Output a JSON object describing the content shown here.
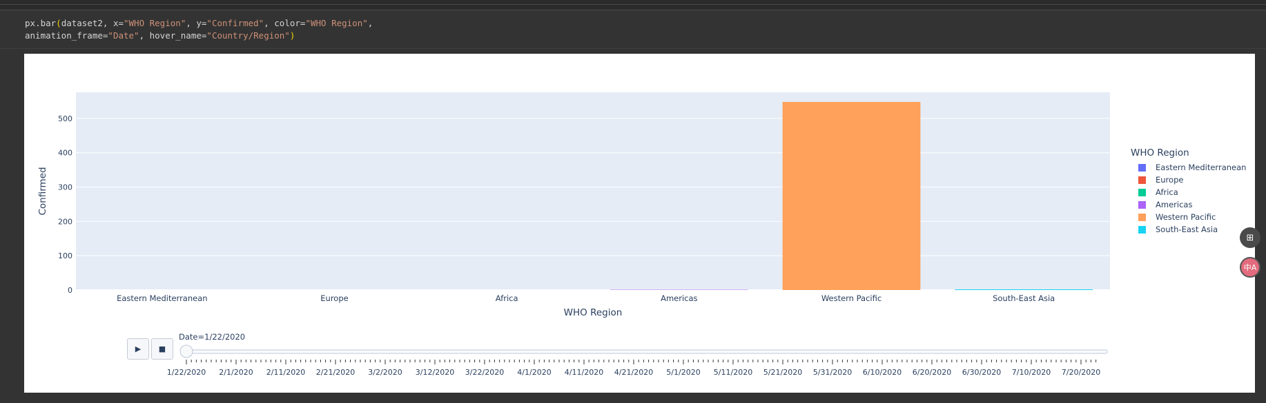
{
  "code": {
    "line1_prefix": "px.bar",
    "line1_paren_open": "(",
    "line1_a": "dataset2, x=",
    "line1_x": "\"WHO Region\"",
    "line1_b": ", y=",
    "line1_y": "\"Confirmed\"",
    "line1_c": ", color=",
    "line1_color": "\"WHO Region\"",
    "line1_d": ",",
    "line2_a": "animation_frame=",
    "line2_anim": "\"Date\"",
    "line2_b": ", hover_name=",
    "line2_hover": "\"Country/Region\"",
    "line2_paren_close": ")"
  },
  "chart_data": {
    "type": "bar",
    "xlabel": "WHO Region",
    "ylabel": "Confirmed",
    "categories": [
      "Eastern Mediterranean",
      "Europe",
      "Africa",
      "Americas",
      "Western Pacific",
      "South-East Asia"
    ],
    "values": [
      0,
      0,
      0,
      1,
      548,
      2
    ],
    "colors": [
      "#636efa",
      "#ef553b",
      "#00cc96",
      "#ab63fa",
      "#ffa15a",
      "#19d3f3"
    ],
    "yticks": [
      0,
      100,
      200,
      300,
      400,
      500
    ],
    "ylim": [
      0,
      576
    ],
    "grid": true,
    "plot_bg": "#e5ecf6",
    "legend": {
      "title": "WHO Region",
      "placement": "right",
      "entries": [
        "Eastern Mediterranean",
        "Europe",
        "Africa",
        "Americas",
        "Western Pacific",
        "South-East Asia"
      ]
    }
  },
  "animation": {
    "current_label": "Date=1/22/2020",
    "play_icon": "play-icon",
    "stop_icon": "stop-icon",
    "position": 0,
    "dates": [
      "1/22/2020",
      "2/1/2020",
      "2/11/2020",
      "2/21/2020",
      "3/2/2020",
      "3/12/2020",
      "3/22/2020",
      "4/1/2020",
      "4/11/2020",
      "4/21/2020",
      "5/1/2020",
      "5/11/2020",
      "5/21/2020",
      "5/31/2020",
      "6/10/2020",
      "6/20/2020",
      "6/30/2020",
      "7/10/2020",
      "7/20/2020"
    ]
  },
  "floating": {
    "apps_icon": "apps-icon",
    "translate_icon": "translate-icon",
    "accent": "#e26b7d"
  }
}
